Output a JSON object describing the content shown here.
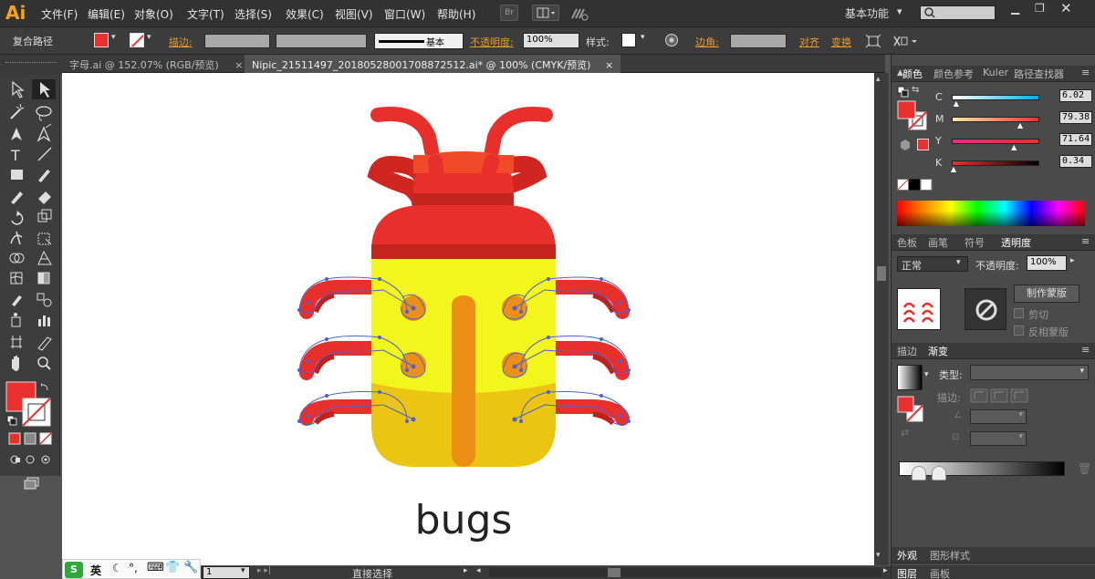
{
  "app": {
    "logo": "Ai",
    "workspace": "基本功能"
  },
  "menu": {
    "items": [
      "文件(F)",
      "编辑(E)",
      "对象(O)",
      "文字(T)",
      "选择(S)",
      "效果(C)",
      "视图(V)",
      "窗口(W)",
      "帮助(H)"
    ],
    "bridge": "Br"
  },
  "control_bar": {
    "selection_type": "复合路径",
    "stroke_label": "描边:",
    "stroke_style": "基本",
    "opacity_label": "不透明度:",
    "opacity_value": "100%",
    "style_label": "样式:",
    "corner_label": "边角:",
    "align_label": "对齐",
    "transform_label": "变换",
    "fill_color": "#e8312e"
  },
  "tabs": [
    {
      "label": "字母.ai @ 152.07% (RGB/预览)",
      "close": "×"
    },
    {
      "label": "Nipic_21511497_20180528001708872512.ai* @ 100% (CMYK/预览)",
      "close": "×"
    }
  ],
  "artwork": {
    "caption": "bugs"
  },
  "color_panel": {
    "tabs": [
      "颜色",
      "颜色参考",
      "Kuler",
      "路径查找器"
    ],
    "channels": [
      {
        "name": "C",
        "value": "6.02",
        "pct": 0.06
      },
      {
        "name": "M",
        "value": "79.38",
        "pct": 0.79
      },
      {
        "name": "Y",
        "value": "71.64",
        "pct": 0.72
      },
      {
        "name": "K",
        "value": "0.34",
        "pct": 0.03
      }
    ]
  },
  "transparency_panel": {
    "tabs": [
      "色板",
      "画笔",
      "符号",
      "透明度"
    ],
    "blend_mode": "正常",
    "opacity_label": "不透明度:",
    "opacity_value": "100%",
    "make_mask": "制作蒙版",
    "clip": "剪切",
    "invert_mask": "反相蒙版"
  },
  "gradient_panel": {
    "tabs": [
      "描边",
      "渐变"
    ],
    "type_label": "类型:",
    "stroke_label": "描边:"
  },
  "bottom_panels": {
    "row1": [
      "外观",
      "图形样式"
    ],
    "row2": [
      "图层",
      "画板"
    ]
  },
  "status_bar": {
    "page": "1",
    "tool": "直接选择"
  },
  "ime": {
    "lang": "英"
  }
}
